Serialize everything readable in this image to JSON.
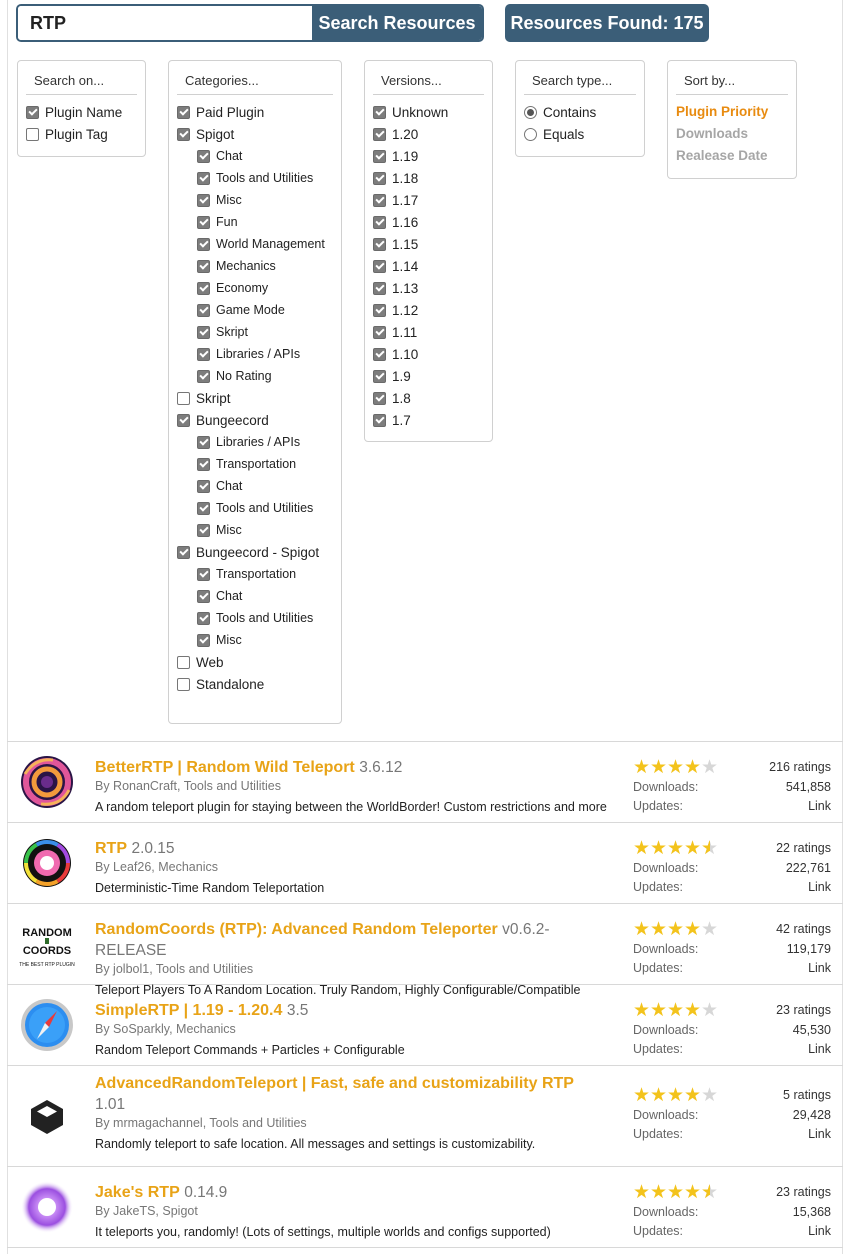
{
  "search": {
    "value": "RTP",
    "button_label": "Search Resources"
  },
  "found": {
    "label": "Resources Found: 175"
  },
  "search_on": {
    "title": "Search on...",
    "options": [
      {
        "label": "Plugin Name",
        "checked": true
      },
      {
        "label": "Plugin Tag",
        "checked": false
      }
    ]
  },
  "categories": {
    "title": "Categories...",
    "items": [
      {
        "label": "Paid Plugin",
        "checked": true,
        "sub": false
      },
      {
        "label": "Spigot",
        "checked": true,
        "sub": false
      },
      {
        "label": "Chat",
        "checked": true,
        "sub": true
      },
      {
        "label": "Tools and Utilities",
        "checked": true,
        "sub": true
      },
      {
        "label": "Misc",
        "checked": true,
        "sub": true
      },
      {
        "label": "Fun",
        "checked": true,
        "sub": true
      },
      {
        "label": "World Management",
        "checked": true,
        "sub": true
      },
      {
        "label": "Mechanics",
        "checked": true,
        "sub": true
      },
      {
        "label": "Economy",
        "checked": true,
        "sub": true
      },
      {
        "label": "Game Mode",
        "checked": true,
        "sub": true
      },
      {
        "label": "Skript",
        "checked": true,
        "sub": true
      },
      {
        "label": "Libraries / APIs",
        "checked": true,
        "sub": true
      },
      {
        "label": "No Rating",
        "checked": true,
        "sub": true
      },
      {
        "label": "Skript",
        "checked": false,
        "sub": false
      },
      {
        "label": "Bungeecord",
        "checked": true,
        "sub": false
      },
      {
        "label": "Libraries / APIs",
        "checked": true,
        "sub": true
      },
      {
        "label": "Transportation",
        "checked": true,
        "sub": true
      },
      {
        "label": "Chat",
        "checked": true,
        "sub": true
      },
      {
        "label": "Tools and Utilities",
        "checked": true,
        "sub": true
      },
      {
        "label": "Misc",
        "checked": true,
        "sub": true
      },
      {
        "label": "Bungeecord - Spigot",
        "checked": true,
        "sub": false
      },
      {
        "label": "Transportation",
        "checked": true,
        "sub": true
      },
      {
        "label": "Chat",
        "checked": true,
        "sub": true
      },
      {
        "label": "Tools and Utilities",
        "checked": true,
        "sub": true
      },
      {
        "label": "Misc",
        "checked": true,
        "sub": true
      },
      {
        "label": "Web",
        "checked": false,
        "sub": false
      },
      {
        "label": "Standalone",
        "checked": false,
        "sub": false
      }
    ]
  },
  "versions": {
    "title": "Versions...",
    "items": [
      {
        "label": "Unknown",
        "checked": true
      },
      {
        "label": "1.20",
        "checked": true
      },
      {
        "label": "1.19",
        "checked": true
      },
      {
        "label": "1.18",
        "checked": true
      },
      {
        "label": "1.17",
        "checked": true
      },
      {
        "label": "1.16",
        "checked": true
      },
      {
        "label": "1.15",
        "checked": true
      },
      {
        "label": "1.14",
        "checked": true
      },
      {
        "label": "1.13",
        "checked": true
      },
      {
        "label": "1.12",
        "checked": true
      },
      {
        "label": "1.11",
        "checked": true
      },
      {
        "label": "1.10",
        "checked": true
      },
      {
        "label": "1.9",
        "checked": true
      },
      {
        "label": "1.8",
        "checked": true
      },
      {
        "label": "1.7",
        "checked": true
      }
    ]
  },
  "search_type": {
    "title": "Search type...",
    "options": [
      {
        "label": "Contains",
        "checked": true
      },
      {
        "label": "Equals",
        "checked": false
      }
    ]
  },
  "sort_by": {
    "title": "Sort by...",
    "options": [
      {
        "label": "Plugin Priority",
        "active": true
      },
      {
        "label": "Downloads",
        "active": false
      },
      {
        "label": "Realease Date",
        "active": false
      }
    ]
  },
  "results": [
    {
      "title": "BetterRTP | Random Wild Teleport",
      "version": "3.6.12",
      "title_line2": "",
      "by": "By RonanCraft, Tools and Utilities",
      "description": "A random teleport plugin for staying between the WorldBorder! Custom restrictions and more",
      "rating_stars": 4.0,
      "ratings": "216 ratings",
      "downloads_label": "Downloads:",
      "downloads": "541,858",
      "updates_label": "Updates:",
      "updates": "Link",
      "icon": "swirl-icon"
    },
    {
      "title": "RTP",
      "version": "2.0.15",
      "title_line2": "",
      "by": "By Leaf26, Mechanics",
      "description": "Deterministic-Time Random Teleportation",
      "rating_stars": 4.5,
      "ratings": "22 ratings",
      "downloads_label": "Downloads:",
      "downloads": "222,761",
      "updates_label": "Updates:",
      "updates": "Link",
      "icon": "rainbow-donut-icon"
    },
    {
      "title": "RandomCoords (RTP): Advanced Random Teleporter",
      "version": "v0.6.2-RELEASE",
      "title_line2": "",
      "by": "By jolbol1, Tools and Utilities",
      "description": "Teleport Players To A Random Location. Truly Random, Highly Configurable/Compatible",
      "rating_stars": 4.0,
      "ratings": "42 ratings",
      "downloads_label": "Downloads:",
      "downloads": "119,179",
      "updates_label": "Updates:",
      "updates": "Link",
      "icon": "randomcoords-logo-icon",
      "logo_text": [
        "RANDOM",
        "COORDS",
        "THE BEST RTP PLUGIN"
      ]
    },
    {
      "title": "SimpleRTP | 1.19 - 1.20.4",
      "version": "3.5",
      "title_line2": "",
      "by": "By SoSparkly, Mechanics",
      "description": "Random Teleport Commands + Particles + Configurable",
      "rating_stars": 4.0,
      "ratings": "23 ratings",
      "downloads_label": "Downloads:",
      "downloads": "45,530",
      "updates_label": "Updates:",
      "updates": "Link",
      "icon": "compass-icon"
    },
    {
      "title": "AdvancedRandomTeleport | Fast, safe and customizability RTP",
      "version": "",
      "title_line2": "1.01",
      "by": "By mrmagachannel, Tools and Utilities",
      "description": "Randomly teleport to safe location. All messages and settings is customizability.",
      "rating_stars": 4.0,
      "ratings": "5 ratings",
      "downloads_label": "Downloads:",
      "downloads": "29,428",
      "updates_label": "Updates:",
      "updates": "Link",
      "icon": "cube-icon"
    },
    {
      "title": "Jake's RTP",
      "version": "0.14.9",
      "title_line2": "",
      "by": "By JakeTS, Spigot",
      "description": "It teleports you, randomly! (Lots of settings, multiple worlds and configs supported)",
      "rating_stars": 4.5,
      "ratings": "23 ratings",
      "downloads_label": "Downloads:",
      "downloads": "15,368",
      "updates_label": "Updates:",
      "updates": "Link",
      "icon": "purple-orb-icon"
    }
  ]
}
